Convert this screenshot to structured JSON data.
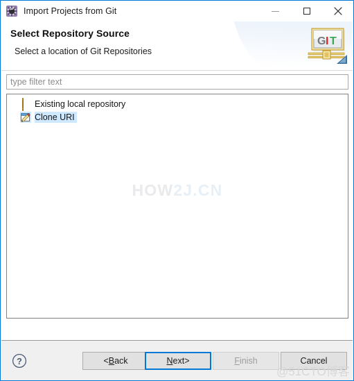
{
  "window": {
    "title": "Import Projects from Git",
    "icon": "eclipse-gear-icon",
    "controls": {
      "minimize": "minimize-icon",
      "maximize": "maximize-icon",
      "close": "close-icon"
    },
    "accent_color": "#0078d7"
  },
  "header": {
    "title": "Select Repository Source",
    "subtitle": "Select a location of Git Repositories",
    "banner_icon": "git-banner-icon",
    "banner_text": {
      "g": "G",
      "i": "I",
      "t": "T"
    },
    "banner_colors": {
      "g": "#77797c",
      "i": "#d8262a",
      "t": "#3aa856"
    }
  },
  "filter": {
    "placeholder": "type filter text",
    "value": ""
  },
  "tree": {
    "items": [
      {
        "label": "Existing local repository",
        "icon": "repository-database-icon",
        "selected": false
      },
      {
        "label": "Clone URI",
        "icon": "clone-uri-edit-icon",
        "selected": true
      }
    ],
    "selection_color": "#cde8ff",
    "watermark": {
      "part1": "HOW",
      "part2": "2J.CN"
    }
  },
  "buttons": {
    "help": "help-icon",
    "back": {
      "prefix": "< ",
      "mnemonic": "B",
      "rest": "ack",
      "enabled": true,
      "default": false
    },
    "next": {
      "mnemonic": "N",
      "rest": "ext",
      "suffix": " >",
      "enabled": true,
      "default": true
    },
    "finish": {
      "mnemonic": "F",
      "rest": "inish",
      "enabled": false,
      "default": false
    },
    "cancel": {
      "mnemonic": "C",
      "rest": "ancel",
      "enabled": true,
      "default": false
    }
  },
  "watermark_bottom": "@51CTO博客"
}
